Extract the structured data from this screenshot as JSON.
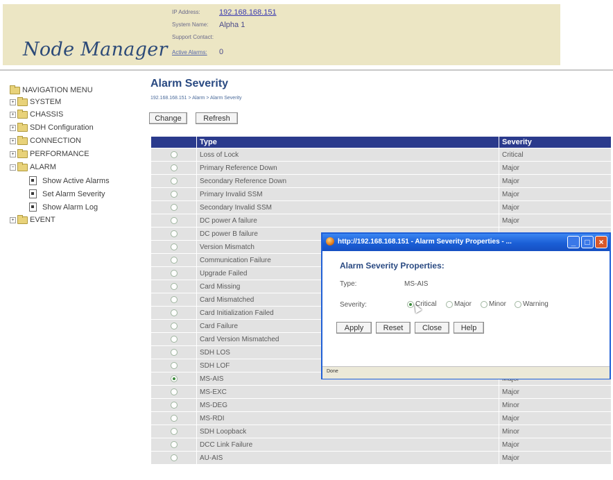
{
  "app": {
    "title": "Node Manager"
  },
  "header": {
    "ip_label": "IP Address:",
    "ip_value": "192.168.168.151",
    "system_name_label": "System Name:",
    "system_name_value": "Alpha 1",
    "support_contact_label": "Support Contact:",
    "support_contact_value": "",
    "active_alarms_label": "Active Alarms:",
    "active_alarms_value": "0"
  },
  "nav": {
    "title": "NAVIGATION MENU",
    "items": [
      {
        "label": "SYSTEM",
        "expander": "+"
      },
      {
        "label": "CHASSIS",
        "expander": "+"
      },
      {
        "label": "SDH Configuration",
        "expander": "+"
      },
      {
        "label": "CONNECTION",
        "expander": "+"
      },
      {
        "label": "PERFORMANCE",
        "expander": "+"
      },
      {
        "label": "ALARM",
        "expander": "−"
      },
      {
        "label": "EVENT",
        "expander": "+"
      }
    ],
    "alarm_children": [
      {
        "label": "Show Active Alarms"
      },
      {
        "label": "Set Alarm Severity"
      },
      {
        "label": "Show Alarm Log"
      }
    ]
  },
  "main": {
    "title": "Alarm Severity",
    "breadcrumb": "192.168.168.151 > Alarm > Alarm Severity",
    "change_button": "Change",
    "refresh_button": "Refresh",
    "columns": {
      "select": "",
      "type": "Type",
      "severity": "Severity"
    },
    "rows": [
      {
        "type": "Loss of Lock",
        "severity": "Critical",
        "selected": false
      },
      {
        "type": "Primary Reference Down",
        "severity": "Major",
        "selected": false
      },
      {
        "type": "Secondary Reference Down",
        "severity": "Major",
        "selected": false
      },
      {
        "type": "Primary Invalid SSM",
        "severity": "Major",
        "selected": false
      },
      {
        "type": "Secondary Invalid SSM",
        "severity": "Major",
        "selected": false
      },
      {
        "type": "DC power A failure",
        "severity": "Major",
        "selected": false
      },
      {
        "type": "DC power B failure",
        "severity": "",
        "selected": false
      },
      {
        "type": "Version Mismatch",
        "severity": "",
        "selected": false
      },
      {
        "type": "Communication Failure",
        "severity": "",
        "selected": false
      },
      {
        "type": "Upgrade Failed",
        "severity": "",
        "selected": false
      },
      {
        "type": "Card Missing",
        "severity": "",
        "selected": false
      },
      {
        "type": "Card Mismatched",
        "severity": "",
        "selected": false
      },
      {
        "type": "Card Initialization Failed",
        "severity": "",
        "selected": false
      },
      {
        "type": "Card Failure",
        "severity": "",
        "selected": false
      },
      {
        "type": "Card Version Mismatched",
        "severity": "",
        "selected": false
      },
      {
        "type": "SDH LOS",
        "severity": "",
        "selected": false
      },
      {
        "type": "SDH LOF",
        "severity": "",
        "selected": false
      },
      {
        "type": "MS-AIS",
        "severity": "Major",
        "selected": true
      },
      {
        "type": "MS-EXC",
        "severity": "Major",
        "selected": false
      },
      {
        "type": "MS-DEG",
        "severity": "Minor",
        "selected": false
      },
      {
        "type": "MS-RDI",
        "severity": "Major",
        "selected": false
      },
      {
        "type": "SDH Loopback",
        "severity": "Minor",
        "selected": false
      },
      {
        "type": "DCC Link Failure",
        "severity": "Major",
        "selected": false
      },
      {
        "type": "AU-AIS",
        "severity": "Major",
        "selected": false
      }
    ]
  },
  "popup": {
    "window_title": "http://192.168.168.151 - Alarm Severity Properties - ...",
    "heading": "Alarm Severity Properties:",
    "type_label": "Type:",
    "type_value": "MS-AIS",
    "severity_label": "Severity:",
    "severity_options": [
      "Critical",
      "Major",
      "Minor",
      "Warning"
    ],
    "severity_selected": "Critical",
    "apply_button": "Apply",
    "reset_button": "Reset",
    "close_button": "Close",
    "help_button": "Help",
    "status_text": "Done",
    "icons": {
      "favicon": "firefox-icon",
      "minimize": "minimize-icon",
      "maximize": "maximize-icon",
      "close": "close-icon"
    }
  },
  "colors": {
    "header_band": "#ece6c4",
    "title_blue": "#2a4a82",
    "table_header": "#2a3a8c",
    "row_bg": "#e2e2e2",
    "popup_titlebar": "#1a5ed6"
  }
}
